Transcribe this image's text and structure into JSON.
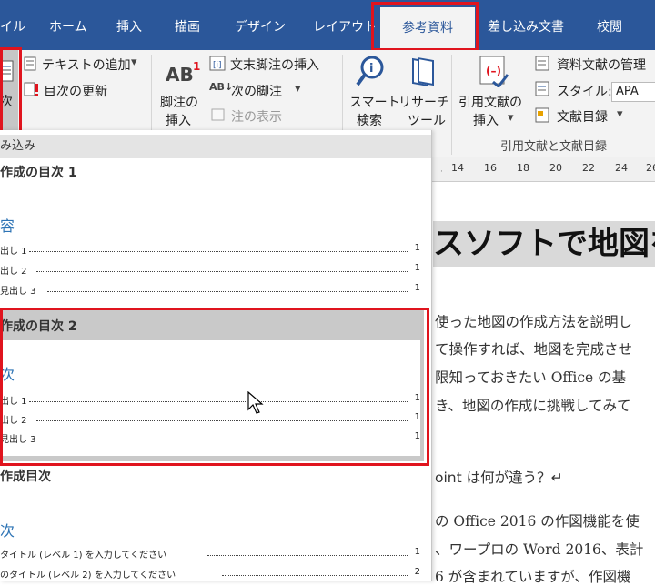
{
  "tabs": [
    "イル",
    "ホーム",
    "挿入",
    "描画",
    "デザイン",
    "レイアウト",
    "参考資料",
    "差し込み文書",
    "校閲"
  ],
  "ribbon": {
    "toc_button_label": "次",
    "add_text": "テキストの追加",
    "update_toc": "目次の更新",
    "insert_footnote_l1": "脚注の",
    "insert_footnote_l2": "挿入",
    "insert_endnote": "文末脚注の挿入",
    "next_footnote": "次の脚注",
    "show_notes": "注の表示",
    "smart_lookup_l1": "スマート",
    "smart_lookup_l2": "検索",
    "researcher_l1": "リサーチ",
    "researcher_l2": "ツール",
    "insert_citation_l1": "引用文献の",
    "insert_citation_l2": "挿入",
    "manage_sources": "資料文献の管理",
    "style_label": "スタイル:",
    "style_value": "APA",
    "bibliography": "文献目録",
    "group_citations": "引用文献と文献目録",
    "footnote_superscript": "1",
    "footnote_icon_text": "AB"
  },
  "ruler": [
    "14",
    "16",
    "18",
    "20",
    "22",
    "24",
    "26"
  ],
  "gallery": {
    "header": "み込み",
    "toc1": {
      "title": "作成の目次 1",
      "subtitle": "容",
      "entries": [
        {
          "text": "出し 1",
          "page": "1"
        },
        {
          "text": "出し 2",
          "page": "1"
        },
        {
          "text": "見出し 3",
          "page": "1"
        }
      ]
    },
    "toc2": {
      "title": "作成の目次 2",
      "subtitle": "次",
      "entries": [
        {
          "text": "出し 1",
          "page": "1"
        },
        {
          "text": "出し 2",
          "page": "1"
        },
        {
          "text": "見出し 3",
          "page": "1"
        }
      ]
    },
    "manual": {
      "title": "作成目次",
      "subtitle": "次",
      "entries": [
        {
          "text": "タイトル (レベル 1) を入力してください",
          "page": "1"
        },
        {
          "text": "のタイトル (レベル 2) を入力してください",
          "page": "2"
        }
      ]
    }
  },
  "document": {
    "heading": "スソフトで地図を",
    "lines": [
      "使った地図の作成方法を説明し",
      "て操作すれば、地図を完成させ",
      "限知っておきたい Office の基",
      "き、地図の作成に挑戦してみて",
      "oint は何が違う？↵",
      "の Office 2016 の作図機能を使",
      "、ワープロの Word 2016、表計",
      "6 が含まれていますが、作図機"
    ]
  },
  "colors": {
    "accent": "#2b579a",
    "highlight": "#e0141e",
    "subtitle": "#2e74b5"
  }
}
